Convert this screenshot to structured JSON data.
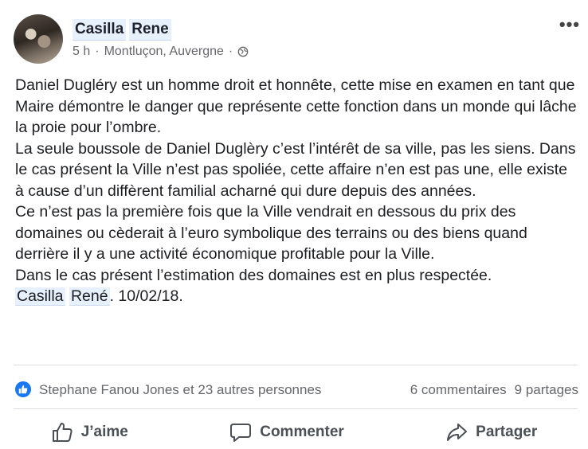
{
  "post": {
    "author_first": "Casilla",
    "author_last": "Rene",
    "time": "5 h",
    "location": "Montluçon, Auvergne",
    "separator": "·",
    "body_paragraphs": [
      "Daniel Dugléry est un homme droit et honnête, cette mise en examen en tant que Maire démontre le danger que représente cette fonction dans un monde qui lâche la proie pour l’ombre.",
      "La seule boussole de Daniel Duglèry c’est l’intérêt de sa ville, pas les siens. Dans le cas présent la Ville n’est pas spoliée, cette affaire n’en est pas une, elle existe à cause d’un diffèrent familial acharné qui dure depuis des années.",
      "Ce n’est pas la première fois que la Ville vendrait en dessous du prix des domaines ou cèderait à l’euro symbolique des terrains ou des biens quand derrière il y a une activité économique profitable pour la Ville.",
      "Dans le cas présent l’estimation des domaines est en plus respectée."
    ],
    "signature_first": "Casilla",
    "signature_last": "René",
    "signature_date": ". 10/02/18."
  },
  "stats": {
    "reactors": "Stephane Fanou Jones et 23 autres personnes",
    "comments": "6 commentaires",
    "shares": "9 partages"
  },
  "actions": {
    "like": "J’aime",
    "comment": "Commenter",
    "share": "Partager"
  },
  "colors": {
    "brand_blue": "#1877f2",
    "tag_bg": "#e7f0fd",
    "muted": "#65676b"
  },
  "icons": [
    "globe-icon",
    "more-options-icon",
    "like-reaction-icon",
    "thumbs-up-icon",
    "comment-icon",
    "share-icon"
  ]
}
